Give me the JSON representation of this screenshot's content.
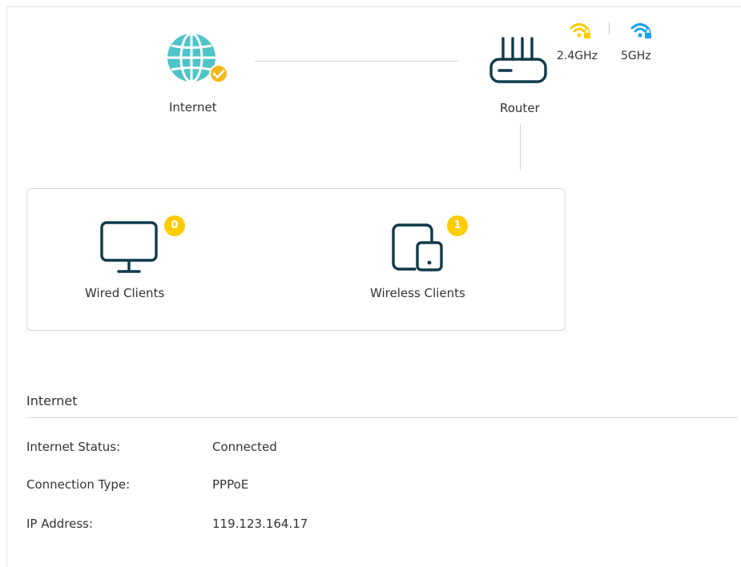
{
  "topology": {
    "internet_label": "Internet",
    "router_label": "Router",
    "band_24_label": "2.4GHz",
    "band_5_label": "5GHz",
    "band_24_color": "#ffcc00",
    "band_5_color": "#1aa3e8",
    "accent_color": "#4fc3c9",
    "device_color": "#0f3a4a"
  },
  "clients": {
    "wired_label": "Wired Clients",
    "wired_count": "0",
    "wireless_label": "Wireless Clients",
    "wireless_count": "1",
    "badge_color": "#ffcc00"
  },
  "internet_section": {
    "title": "Internet",
    "rows": [
      {
        "label": "Internet Status:",
        "value": "Connected"
      },
      {
        "label": "Connection Type:",
        "value": "PPPoE"
      },
      {
        "label": "IP Address:",
        "value": "119.123.164.17"
      }
    ]
  }
}
